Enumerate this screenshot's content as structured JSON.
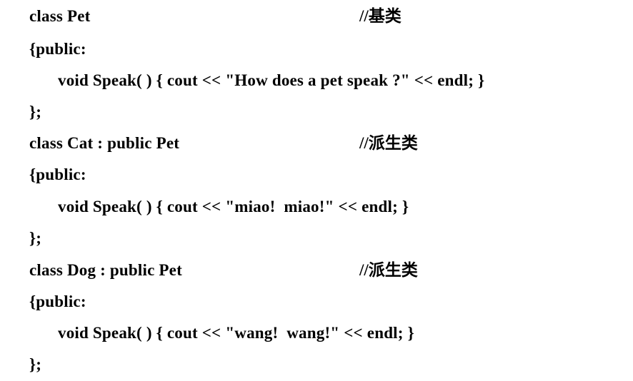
{
  "code": {
    "lines": [
      {
        "code": "class Pet",
        "comment": "//基类"
      },
      {
        "code": "{public:"
      },
      {
        "code": "void Speak( ) { cout << \"How does a pet speak ?\" << endl; }"
      },
      {
        "code": "};"
      },
      {
        "code": "class Cat : public Pet",
        "comment": "//派生类"
      },
      {
        "code": "{public:"
      },
      {
        "code": "void Speak( ) { cout << \"miao!  miao!\" << endl; }"
      },
      {
        "code": "};"
      },
      {
        "code": "class Dog : public Pet",
        "comment": "//派生类"
      },
      {
        "code": "{public:"
      },
      {
        "code": "void Speak( ) { cout << \"wang!  wang!\" << endl; }"
      },
      {
        "code": "};"
      }
    ]
  }
}
